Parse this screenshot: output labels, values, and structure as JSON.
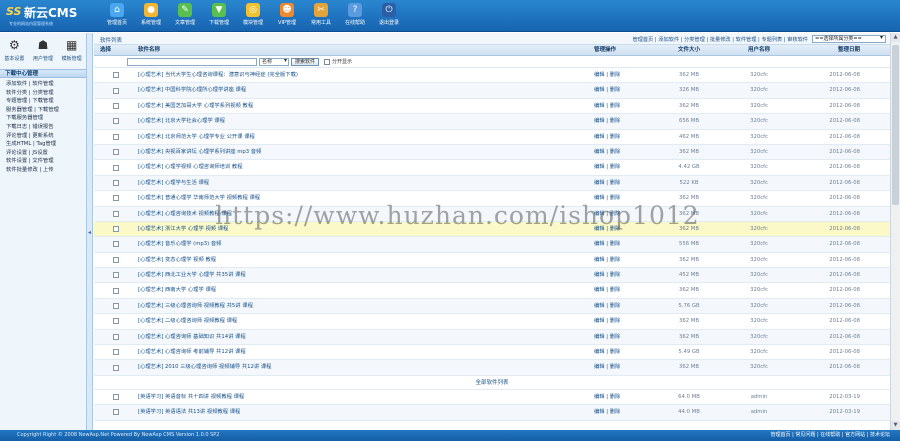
{
  "header": {
    "logo_mark": "SS",
    "logo_name": "新云CMS",
    "logo_sub": "专业的网站内容管理系统",
    "nav": [
      {
        "label": "管理首页",
        "icon": "home-icon",
        "glyph": "⌂",
        "color": "#4aa8f0"
      },
      {
        "label": "系统管理",
        "icon": "system-icon",
        "glyph": "●",
        "color": "#f2b632"
      },
      {
        "label": "文章管理",
        "icon": "article-icon",
        "glyph": "✎",
        "color": "#59c04f"
      },
      {
        "label": "下载管理",
        "icon": "download-icon",
        "glyph": "▼",
        "color": "#59c04f"
      },
      {
        "label": "模块管理",
        "icon": "module-icon",
        "glyph": "◎",
        "color": "#f2c12e"
      },
      {
        "label": "VIP管理",
        "icon": "vip-icon",
        "glyph": "☻",
        "color": "#f08a2e"
      },
      {
        "label": "常用工具",
        "icon": "tools-icon",
        "glyph": "✂",
        "color": "#e5a43a"
      },
      {
        "label": "在线帮助",
        "icon": "help-icon",
        "glyph": "?",
        "color": "#5a9be0"
      },
      {
        "label": "退出登录",
        "icon": "logout-icon",
        "glyph": "⏻",
        "color": "#2c5fa8"
      }
    ]
  },
  "sidebar": {
    "quick": [
      {
        "label": "基本设置",
        "icon": "settings-icon",
        "glyph": "⚙"
      },
      {
        "label": "用户管理",
        "icon": "user-icon",
        "glyph": "☗"
      },
      {
        "label": "模板管理",
        "icon": "template-icon",
        "glyph": "▦"
      }
    ],
    "title": "下载中心管理",
    "links": [
      "添加软件 | 软件管理",
      "软件分类 | 分类管理",
      "专题管理 | 下载管理",
      "服务器管理 | 下载管理",
      "下载服务器管理",
      "下载日志 | 错误报告",
      "评论管理 | 更新系统",
      "生成HTML | Tag管理",
      "评论设置 | JS设置",
      "软件设置 | 文件管理",
      "软件批量修改 | 上传"
    ]
  },
  "main": {
    "breadcrumb_title": "软件列表",
    "breadcrumb_links": "管理首页 | 添加软件 | 分类管理 | 批量修改 | 软件管理 | 专题列表 | 审核软件",
    "category_select": "==选择所属分类==",
    "columns": {
      "select": "选择",
      "name": "软件名称",
      "op": "管理操作",
      "size": "文件大小",
      "author": "用户名称",
      "date": "整理日期"
    },
    "search": {
      "scope": "名称",
      "button": "搜索软件",
      "check_label": "分开显示"
    },
    "op_label": "编辑 | 删除",
    "rows": [
      {
        "name": "[心理艺术] 当代大学生心理咨询课程：潜意识与神经症 (完全版下载)",
        "size": "362 MB",
        "author": "320cfc",
        "date": "2012-06-08"
      },
      {
        "name": "[心理艺术] 中国科学院心理所心理学讲座 课程",
        "size": "326 MB",
        "author": "320cfc",
        "date": "2012-06-08"
      },
      {
        "name": "[心理艺术] 美国芝加哥大学 心理学系列视频 教程",
        "size": "362 MB",
        "author": "320cfc",
        "date": "2012-06-08"
      },
      {
        "name": "[心理艺术] 北京大学社会心理学 课程",
        "size": "656 MB",
        "author": "320cfc",
        "date": "2012-06-08"
      },
      {
        "name": "[心理艺术] 北京师范大学 心理学专业 公开课 课程",
        "size": "462 MB",
        "author": "320cfc",
        "date": "2012-06-08"
      },
      {
        "name": "[心理艺术] 央视百家讲坛 心理学系列讲座 mp3 音频",
        "size": "362 MB",
        "author": "320cfc",
        "date": "2012-06-08"
      },
      {
        "name": "[心理艺术] 心理学视频 心理咨询师培训 教程",
        "size": "4.42 GB",
        "author": "320cfc",
        "date": "2012-06-08"
      },
      {
        "name": "[心理艺术] 心理学与生活 课程",
        "size": "522 KB",
        "author": "320cfc",
        "date": "2012-06-08"
      },
      {
        "name": "[心理艺术] 普通心理学 华南师范大学 视频教程 课程",
        "size": "362 MB",
        "author": "320cfc",
        "date": "2012-06-08"
      },
      {
        "name": "[心理艺术] 心理咨询技术 视频教程 课程",
        "size": "362 MB",
        "author": "320cfc",
        "date": "2012-06-08"
      },
      {
        "name": "[心理艺术] 浙江大学 心理学 视频 课程",
        "size": "362 MB",
        "author": "320cfc",
        "date": "2012-06-08"
      },
      {
        "name": "[心理艺术] 音乐心理学 (mp3) 音频",
        "size": "556 MB",
        "author": "320cfc",
        "date": "2012-06-08"
      },
      {
        "name": "[心理艺术] 变态心理学 视频 教程",
        "size": "362 MB",
        "author": "320cfc",
        "date": "2012-06-08"
      },
      {
        "name": "[心理艺术] 西北工业大学 心理学 共35讲 课程",
        "size": "452 MB",
        "author": "320cfc",
        "date": "2012-06-08"
      },
      {
        "name": "[心理艺术] 西南大学 心理学 课程",
        "size": "362 MB",
        "author": "320cfc",
        "date": "2012-06-08"
      },
      {
        "name": "[心理艺术] 三级心理咨询师 视频教程 共5讲 课程",
        "size": "5.76 GB",
        "author": "320cfc",
        "date": "2012-06-08"
      },
      {
        "name": "[心理艺术] 二级心理咨询师 视频教程 课程",
        "size": "362 MB",
        "author": "320cfc",
        "date": "2012-06-08"
      },
      {
        "name": "[心理艺术] 心理咨询师 基础知识 共14讲 课程",
        "size": "362 MB",
        "author": "320cfc",
        "date": "2012-06-08"
      },
      {
        "name": "[心理艺术] 心理咨询师 考前辅导 共12讲 课程",
        "size": "5.49 GB",
        "author": "320cfc",
        "date": "2012-06-08"
      },
      {
        "name": "[心理艺术] 2010 三级心理咨询师 视频辅导 共12讲 课程",
        "size": "362 MB",
        "author": "320cfc",
        "date": "2012-06-08"
      }
    ],
    "group_label": "全部软件列表",
    "group_rows": [
      {
        "name": "[英语学习] 英语音标 共十四讲 视频教程 课程",
        "size": "64.0 MB",
        "author": "admin",
        "date": "2012-03-19"
      },
      {
        "name": "[英语学习] 英语语法 共13讲 视频教程 课程",
        "size": "44.0 MB",
        "author": "admin",
        "date": "2012-03-19"
      }
    ]
  },
  "watermark": "https://www.huzhan.com/ishop1012",
  "footer": {
    "copyright": "Copyright Right © 2008 NewAsp.Net Powered By NewAsp CMS Version 1.0.0 SP2",
    "links": "管理首页 | 常见问题 | 在线帮助 | 官方网站 | 技术论坛"
  }
}
